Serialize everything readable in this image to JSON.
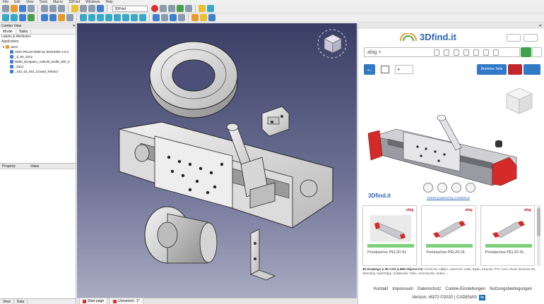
{
  "menu": [
    "File",
    "Edit",
    "View",
    "Tools",
    "Macro",
    "3DFind",
    "Windows",
    "Help"
  ],
  "toolbar": {
    "workbench": "3DFind"
  },
  "combo_view": {
    "title": "Combo View",
    "tabs": [
      "Model",
      "Tasks"
    ],
    "section": "Labels & Attributes",
    "root": "Application",
    "document": "anes",
    "items": [
      "AfaG PEL20-0080-SL 50444484 V.0.0",
      "_5_60_1012",
      "N800_Einspann_Aufscht_Endb_000_0",
      "_0412",
      "_410_02_001_Closed_Retract"
    ],
    "property_headers": [
      "Property",
      "Value"
    ],
    "bottom_tabs": [
      "View",
      "Data"
    ]
  },
  "doc_tabs": [
    "Start page",
    "Unnamed : 1*"
  ],
  "find": {
    "brand": "3Dfind.it",
    "search_value": "afag",
    "similar_label": "Ähnliche Teile",
    "copyright": "©2020 powered by CADENAS",
    "results": [
      {
        "brand": "afag",
        "label": "Portalachse PEL20-SL"
      },
      {
        "brand": "afag",
        "label": "Portalachse PEL20-SL"
      },
      {
        "brand": "afag",
        "label": "Portalachse PEL20-SL"
      }
    ],
    "info_title": "3D Drawings & 3D CAD & BIM Objects For",
    "info_text": "ArchiCAD, Allplan, AutoCAD, Catia, Eplan, Inventor, PTC Creo, Revit, Siemens NX, Sketchup, Solid Edge, Solidworks, Tekla, Vectorworks, Zuken ...",
    "footer_links": [
      "Kontakt",
      "Impressum",
      "Datenschutz",
      "Cookie-Einstellungen",
      "Nutzungsbedingungen"
    ],
    "version": "Version: r6372 ©2020 | CADENAS",
    "linkedin": "in"
  },
  "colors": {
    "accent": "#2f79c7",
    "brand_red": "#c0262b",
    "viewport_top": "#3a3e66",
    "viewport_bottom": "#a9abc2"
  }
}
